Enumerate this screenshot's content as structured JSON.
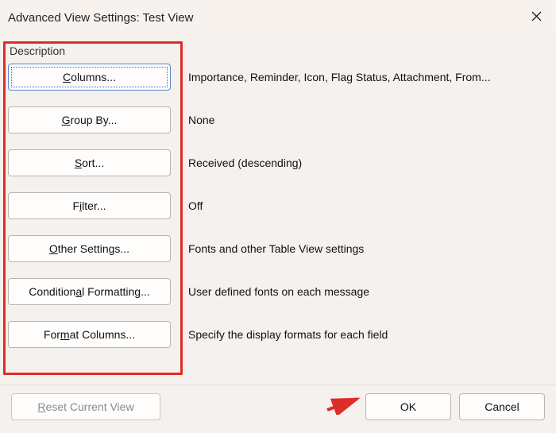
{
  "titlebar": {
    "title": "Advanced View Settings: Test View"
  },
  "group_label": "Description",
  "rows": [
    {
      "button": {
        "pre": "",
        "u": "C",
        "post": "olumns..."
      },
      "desc": "Importance, Reminder, Icon, Flag Status, Attachment, From..."
    },
    {
      "button": {
        "pre": "",
        "u": "G",
        "post": "roup By..."
      },
      "desc": "None"
    },
    {
      "button": {
        "pre": "",
        "u": "S",
        "post": "ort..."
      },
      "desc": "Received (descending)"
    },
    {
      "button": {
        "pre": "F",
        "u": "i",
        "post": "lter..."
      },
      "desc": "Off"
    },
    {
      "button": {
        "pre": "",
        "u": "O",
        "post": "ther Settings..."
      },
      "desc": "Fonts and other Table View settings"
    },
    {
      "button": {
        "pre": "Condition",
        "u": "a",
        "post": "l Formatting..."
      },
      "desc": "User defined fonts on each message"
    },
    {
      "button": {
        "pre": "For",
        "u": "m",
        "post": "at Columns..."
      },
      "desc": "Specify the display formats for each field"
    }
  ],
  "footer": {
    "reset": {
      "pre": "",
      "u": "R",
      "post": "eset Current View"
    },
    "ok": "OK",
    "cancel": "Cancel"
  }
}
